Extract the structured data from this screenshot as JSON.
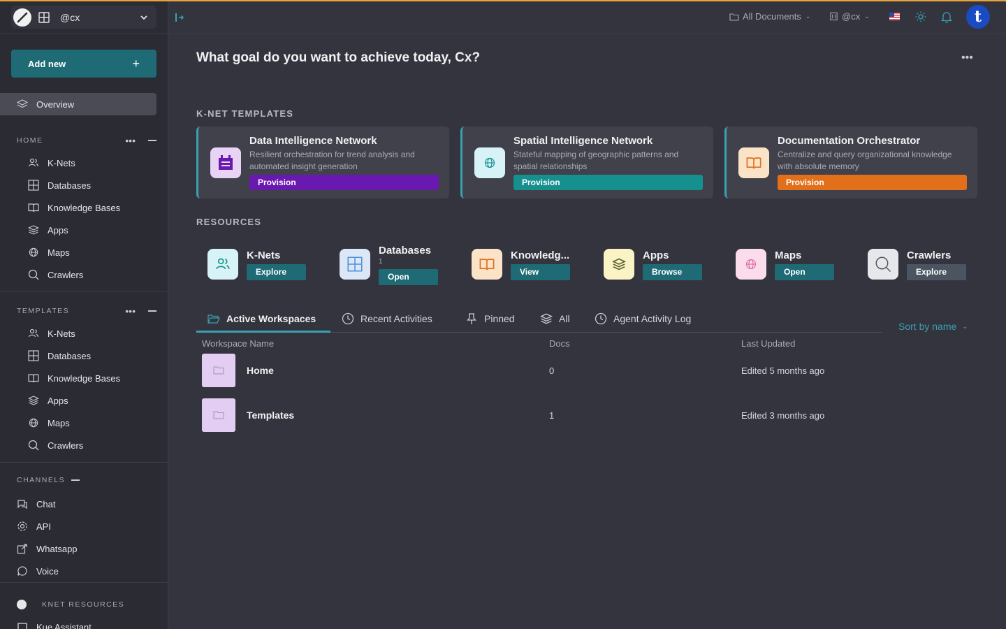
{
  "workspace": {
    "name": "@cx"
  },
  "sidebar": {
    "add_new": "Add new",
    "overview": "Overview",
    "home_section": "HOME",
    "home_items": [
      "K-Nets",
      "Databases",
      "Knowledge Bases",
      "Apps",
      "Maps",
      "Crawlers"
    ],
    "templates_section": "TEMPLATES",
    "template_items": [
      "K-Nets",
      "Databases",
      "Knowledge Bases",
      "Apps",
      "Maps",
      "Crawlers"
    ],
    "channels_section": "CHANNELS",
    "channel_items": [
      "Chat",
      "API",
      "Whatsapp",
      "Voice"
    ],
    "knet_resources": "KNET RESOURCES",
    "knet_resource_item": "Kue Assistant"
  },
  "topbar": {
    "documents": "All Documents",
    "account": "@cx",
    "avatar_letter": "t"
  },
  "main": {
    "greeting": "What goal do you want to achieve today, Cx?",
    "templates_label": "K-NET TEMPLATES",
    "templates": [
      {
        "title": "Data Intelligence Network",
        "desc": "Resilient orchestration for trend analysis and automated insight generation",
        "button": "Provision",
        "color": "#6a19b0",
        "icon_bg": "#e8d3f5",
        "icon": "bot-icon"
      },
      {
        "title": "Spatial Intelligence Network",
        "desc": "Stateful mapping of geographic patterns and spatial relationships",
        "button": "Provision",
        "color": "#16908f",
        "icon_bg": "#d7f3f7",
        "icon": "globe-icon"
      },
      {
        "title": "Documentation Orchestrator",
        "desc": "Centralize and query organizational knowledge with absolute memory",
        "button": "Provision",
        "color": "#e26f1a",
        "icon_bg": "#fbe3c8",
        "icon": "book-icon"
      }
    ],
    "resources_label": "RESOURCES",
    "resources": [
      {
        "title": "K-Nets",
        "button": "Explore",
        "icon_bg": "#d7f3f7",
        "icon": "users-icon"
      },
      {
        "title": "Databases",
        "count": "1",
        "button": "Open",
        "icon_bg": "#dbe7f7",
        "icon": "table-icon"
      },
      {
        "title": "Knowledg...",
        "button": "View",
        "icon_bg": "#fbe3c8",
        "icon": "book-icon"
      },
      {
        "title": "Apps",
        "button": "Browse",
        "icon_bg": "#faf3c5",
        "icon": "layers-icon"
      },
      {
        "title": "Maps",
        "button": "Open",
        "icon_bg": "#fadcea",
        "icon": "globe-icon"
      },
      {
        "title": "Crawlers",
        "button": "Explore",
        "icon_bg": "#e6e7ea",
        "icon": "search-icon"
      }
    ],
    "tabs": [
      "Active Workspaces",
      "Recent Activities",
      "Pinned",
      "All",
      "Agent Activity Log"
    ],
    "sort": "Sort by name",
    "columns": [
      "Workspace Name",
      "Docs",
      "Last Updated"
    ],
    "rows": [
      {
        "name": "Home",
        "docs": "0",
        "updated": "Edited 5 months ago"
      },
      {
        "name": "Templates",
        "docs": "1",
        "updated": "Edited 3 months ago"
      }
    ]
  }
}
